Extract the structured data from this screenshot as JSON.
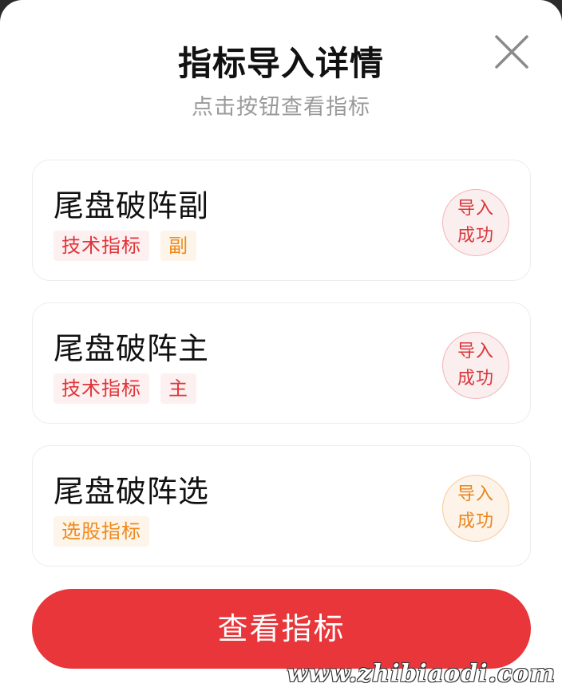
{
  "dialog": {
    "title": "指标导入详情",
    "subtitle": "点击按钮查看指标",
    "close_icon": "close-icon"
  },
  "items": [
    {
      "name": "尾盘破阵副",
      "tags": [
        {
          "label": "技术指标",
          "color": "#e0353a"
        },
        {
          "label": "副",
          "color": "#ef8a1c"
        }
      ],
      "status_line1": "导入",
      "status_line2": "成功",
      "status_color": "#d9363b"
    },
    {
      "name": "尾盘破阵主",
      "tags": [
        {
          "label": "技术指标",
          "color": "#e0353a"
        },
        {
          "label": "主",
          "color": "#e0353a"
        }
      ],
      "status_line1": "导入",
      "status_line2": "成功",
      "status_color": "#d9363b"
    },
    {
      "name": "尾盘破阵选",
      "tags": [
        {
          "label": "选股指标",
          "color": "#ef8a1c"
        }
      ],
      "status_line1": "导入",
      "status_line2": "成功",
      "status_color": "#e8861f"
    }
  ],
  "primary_button": {
    "label": "查看指标",
    "color": "#e8363a"
  },
  "watermark": "www.zhibiaodi.com"
}
